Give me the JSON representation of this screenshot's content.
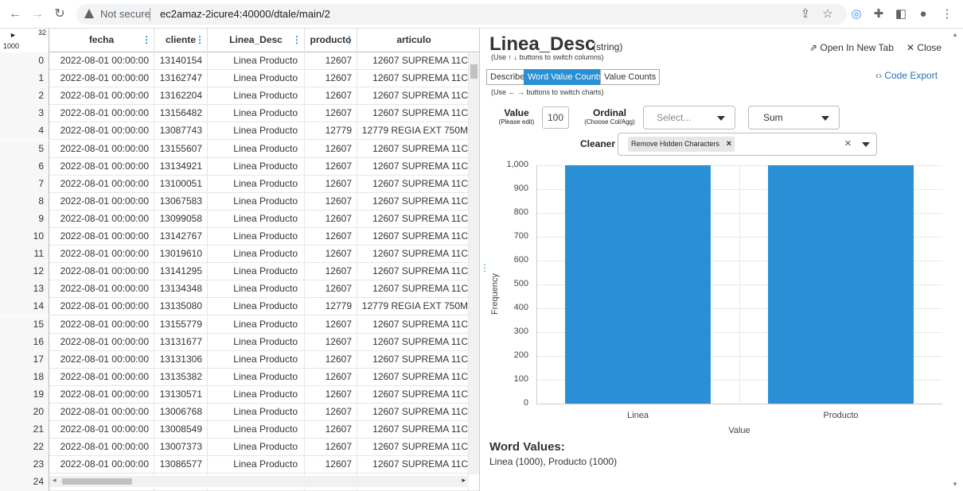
{
  "browser": {
    "not_secure_label": "Not secure",
    "url": "ec2amaz-2icure4:40000/dtale/main/2",
    "icons": [
      "back-icon",
      "forward-icon",
      "reload-icon",
      "share-icon",
      "star-icon",
      "extension-circle-icon",
      "puzzle-icon",
      "sidepanel-icon",
      "profile-icon",
      "kebab-menu-icon"
    ]
  },
  "grid": {
    "col_count": "32",
    "row_count": "1000",
    "columns": [
      "fecha",
      "cliente",
      "Linea_Desc",
      "producto",
      "articulo"
    ],
    "rows": [
      {
        "i": "0",
        "fecha": "2022-08-01 00:00:00",
        "cliente": "13140154",
        "linea": "Linea Producto",
        "producto": "12607",
        "articulo": "12607 SUPREMA 11C"
      },
      {
        "i": "1",
        "fecha": "2022-08-01 00:00:00",
        "cliente": "13162747",
        "linea": "Linea Producto",
        "producto": "12607",
        "articulo": "12607 SUPREMA 11C"
      },
      {
        "i": "2",
        "fecha": "2022-08-01 00:00:00",
        "cliente": "13162204",
        "linea": "Linea Producto",
        "producto": "12607",
        "articulo": "12607 SUPREMA 11C"
      },
      {
        "i": "3",
        "fecha": "2022-08-01 00:00:00",
        "cliente": "13156482",
        "linea": "Linea Producto",
        "producto": "12607",
        "articulo": "12607 SUPREMA 11C"
      },
      {
        "i": "4",
        "fecha": "2022-08-01 00:00:00",
        "cliente": "13087743",
        "linea": "Linea Producto",
        "producto": "12779",
        "articulo": "12779 REGIA EXT 750M"
      },
      {
        "i": "5",
        "fecha": "2022-08-01 00:00:00",
        "cliente": "13155607",
        "linea": "Linea Producto",
        "producto": "12607",
        "articulo": "12607 SUPREMA 11C"
      },
      {
        "i": "6",
        "fecha": "2022-08-01 00:00:00",
        "cliente": "13134921",
        "linea": "Linea Producto",
        "producto": "12607",
        "articulo": "12607 SUPREMA 11C"
      },
      {
        "i": "7",
        "fecha": "2022-08-01 00:00:00",
        "cliente": "13100051",
        "linea": "Linea Producto",
        "producto": "12607",
        "articulo": "12607 SUPREMA 11C"
      },
      {
        "i": "8",
        "fecha": "2022-08-01 00:00:00",
        "cliente": "13067583",
        "linea": "Linea Producto",
        "producto": "12607",
        "articulo": "12607 SUPREMA 11C"
      },
      {
        "i": "9",
        "fecha": "2022-08-01 00:00:00",
        "cliente": "13099058",
        "linea": "Linea Producto",
        "producto": "12607",
        "articulo": "12607 SUPREMA 11C"
      },
      {
        "i": "10",
        "fecha": "2022-08-01 00:00:00",
        "cliente": "13142767",
        "linea": "Linea Producto",
        "producto": "12607",
        "articulo": "12607 SUPREMA 11C"
      },
      {
        "i": "11",
        "fecha": "2022-08-01 00:00:00",
        "cliente": "13019610",
        "linea": "Linea Producto",
        "producto": "12607",
        "articulo": "12607 SUPREMA 11C"
      },
      {
        "i": "12",
        "fecha": "2022-08-01 00:00:00",
        "cliente": "13141295",
        "linea": "Linea Producto",
        "producto": "12607",
        "articulo": "12607 SUPREMA 11C"
      },
      {
        "i": "13",
        "fecha": "2022-08-01 00:00:00",
        "cliente": "13134348",
        "linea": "Linea Producto",
        "producto": "12607",
        "articulo": "12607 SUPREMA 11C"
      },
      {
        "i": "14",
        "fecha": "2022-08-01 00:00:00",
        "cliente": "13135080",
        "linea": "Linea Producto",
        "producto": "12779",
        "articulo": "12779 REGIA EXT 750M"
      },
      {
        "i": "15",
        "fecha": "2022-08-01 00:00:00",
        "cliente": "13155779",
        "linea": "Linea Producto",
        "producto": "12607",
        "articulo": "12607 SUPREMA 11C"
      },
      {
        "i": "16",
        "fecha": "2022-08-01 00:00:00",
        "cliente": "13131677",
        "linea": "Linea Producto",
        "producto": "12607",
        "articulo": "12607 SUPREMA 11C"
      },
      {
        "i": "17",
        "fecha": "2022-08-01 00:00:00",
        "cliente": "13131306",
        "linea": "Linea Producto",
        "producto": "12607",
        "articulo": "12607 SUPREMA 11C"
      },
      {
        "i": "18",
        "fecha": "2022-08-01 00:00:00",
        "cliente": "13135382",
        "linea": "Linea Producto",
        "producto": "12607",
        "articulo": "12607 SUPREMA 11C"
      },
      {
        "i": "19",
        "fecha": "2022-08-01 00:00:00",
        "cliente": "13130571",
        "linea": "Linea Producto",
        "producto": "12607",
        "articulo": "12607 SUPREMA 11C"
      },
      {
        "i": "20",
        "fecha": "2022-08-01 00:00:00",
        "cliente": "13006768",
        "linea": "Linea Producto",
        "producto": "12607",
        "articulo": "12607 SUPREMA 11C"
      },
      {
        "i": "21",
        "fecha": "2022-08-01 00:00:00",
        "cliente": "13008549",
        "linea": "Linea Producto",
        "producto": "12607",
        "articulo": "12607 SUPREMA 11C"
      },
      {
        "i": "22",
        "fecha": "2022-08-01 00:00:00",
        "cliente": "13007373",
        "linea": "Linea Producto",
        "producto": "12607",
        "articulo": "12607 SUPREMA 11C"
      },
      {
        "i": "23",
        "fecha": "2022-08-01 00:00:00",
        "cliente": "13086577",
        "linea": "Linea Producto",
        "producto": "12607",
        "articulo": "12607 SUPREMA 11C"
      },
      {
        "i": "24",
        "fecha": "",
        "cliente": "",
        "linea": "",
        "producto": "",
        "articulo": ""
      }
    ]
  },
  "panel": {
    "title": "Linea_Desc",
    "dtype": "(string)",
    "switch_cols_hint": "(Use ↑ ↓ buttons to switch columns)",
    "open_new_tab": "Open In New Tab",
    "close": "Close",
    "tabs": [
      "Describe",
      "Word Value Counts",
      "Value Counts"
    ],
    "active_tab": "Word Value Counts",
    "switch_charts_hint": "(Use ← → buttons to switch charts)",
    "code_export": "Code Export",
    "value_label": "Value",
    "value_sub": "(Please edit)",
    "value_input": "100",
    "ordinal_label": "Ordinal",
    "ordinal_sub": "(Choose Col/Agg)",
    "ordinal_placeholder": "Select...",
    "agg_value": "Sum",
    "cleaner_label": "Cleaner",
    "cleaner_tag": "Remove Hidden Characters",
    "word_values_title": "Word Values:",
    "word_values_text": "Linea (1000), Producto (1000)",
    "accent_color": "#2a8fd4"
  },
  "chart_data": {
    "type": "bar",
    "categories": [
      "Linea",
      "Producto"
    ],
    "values": [
      1000,
      1000
    ],
    "xlabel": "Value",
    "ylabel": "Frequency",
    "ylim": [
      0,
      1000
    ],
    "yticks": [
      "1,000",
      "900",
      "800",
      "700",
      "600",
      "500",
      "400",
      "300",
      "200",
      "100",
      "0"
    ],
    "grid": true
  }
}
